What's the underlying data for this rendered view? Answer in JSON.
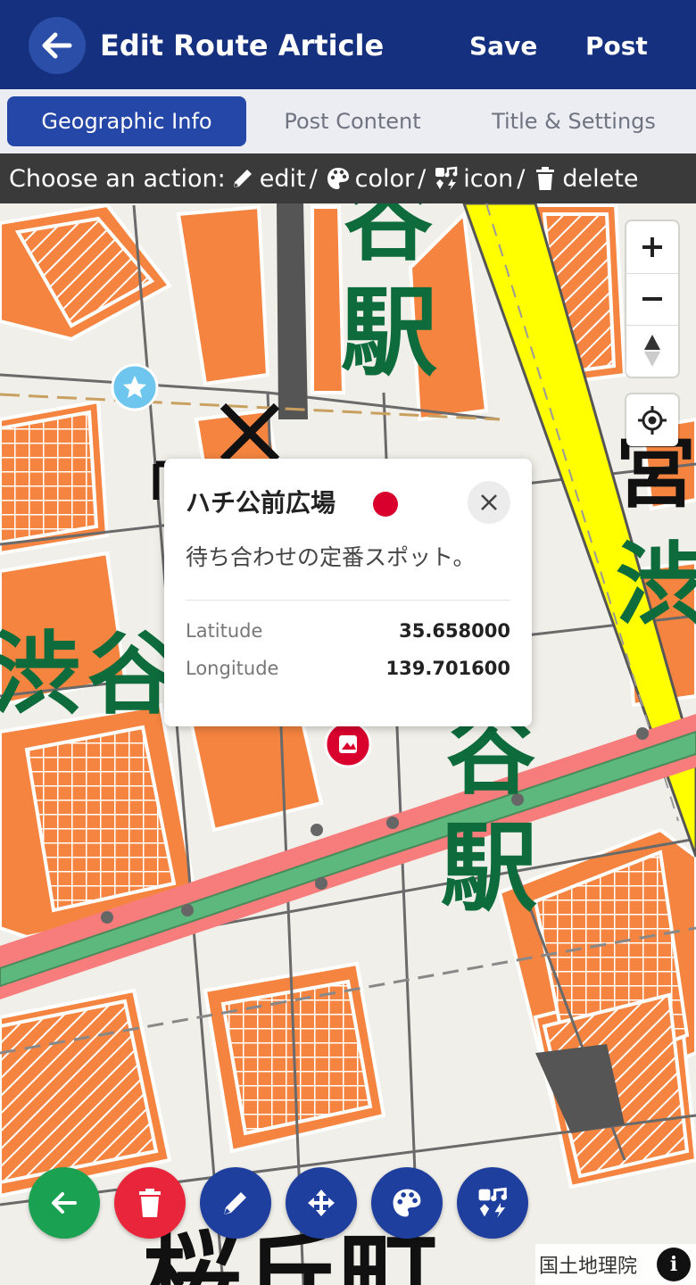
{
  "header": {
    "title": "Edit Route Article",
    "save_label": "Save",
    "post_label": "Post"
  },
  "tabs": [
    {
      "label": "Geographic Info",
      "active": true
    },
    {
      "label": "Post Content",
      "active": false
    },
    {
      "label": "Title & Settings",
      "active": false
    }
  ],
  "hint": {
    "prefix": "Choose an action:",
    "edit": "edit",
    "color": "color",
    "icon": "icon",
    "delete": "delete",
    "sep": "/"
  },
  "map_labels": {
    "station_top": "谷",
    "station_top_2": "駅",
    "shibuya_left_1": "渋",
    "shibuya_left_2": "谷",
    "station_right_1": "谷",
    "station_right_2": "駅",
    "shibuya_right": "渋",
    "miya": "宮",
    "sakuragaoka": "桜丘町"
  },
  "popup": {
    "title": "ハチ公前広場",
    "description": "待ち合わせの定番スポット。",
    "dot_color": "#d9002e",
    "latitude_label": "Latitude",
    "latitude_value": "35.658000",
    "longitude_label": "Longitude",
    "longitude_value": "139.701600"
  },
  "attribution": {
    "text": "国土地理院",
    "info": "i"
  },
  "colors": {
    "header": "#14307f",
    "tab_active": "#2447a8",
    "fab_back": "#1aa152",
    "fab_delete": "#e8253a",
    "fab_primary": "#1f3f9f",
    "railway_green": "#5cb87c",
    "railway_red": "#f77c7c",
    "road_yellow": "#ffff00",
    "building_orange": "#f4843f"
  },
  "icons": {
    "header_back": "arrow-left-icon",
    "zoom_in": "plus-icon",
    "zoom_out": "minus-icon",
    "compass": "compass-icon",
    "locate": "crosshair-icon"
  }
}
